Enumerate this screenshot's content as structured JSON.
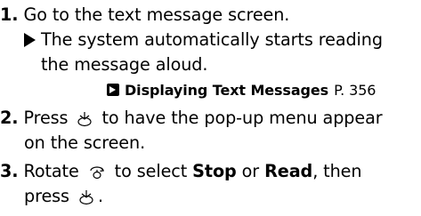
{
  "steps": [
    {
      "number": "1.",
      "text": "Go to the text message screen.",
      "note_line1": "The system automatically starts reading",
      "note_line2": "the message aloud.",
      "xref_title": "Displaying Text Messages",
      "xref_page": "P. 356"
    },
    {
      "number": "2.",
      "text_before_icon": "Press",
      "icon": "enter-button-icon",
      "text_after_icon": "to have the pop-up menu appear",
      "text_line2": "on the screen."
    },
    {
      "number": "3.",
      "text_before_icon": "Rotate",
      "icon": "rotary-knob-icon",
      "text_mid": "to select",
      "option1": "Stop",
      "or_word": "or",
      "option2": "Read",
      "text_after": ", then",
      "line2_before_icon": "press",
      "line2_icon": "enter-button-icon",
      "line2_after_icon": "."
    }
  ]
}
